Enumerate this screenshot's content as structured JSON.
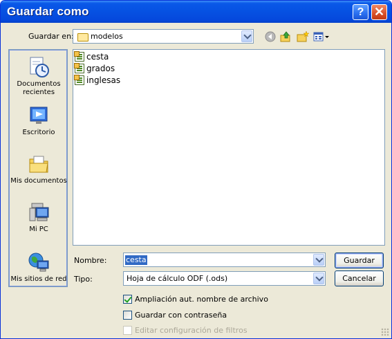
{
  "window": {
    "title": "Guardar como",
    "help_glyph": "?",
    "close_glyph": "✕"
  },
  "location": {
    "label": "Guardar en:",
    "value": "modelos"
  },
  "toolbar": {
    "icons": [
      "back-icon",
      "up-folder-icon",
      "new-folder-icon",
      "view-menu-icon"
    ]
  },
  "places": [
    {
      "label": "Documentos recientes",
      "icon": "recent-documents-icon"
    },
    {
      "label": "Escritorio",
      "icon": "desktop-icon"
    },
    {
      "label": "Mis documentos",
      "icon": "my-documents-icon"
    },
    {
      "label": "Mi PC",
      "icon": "my-computer-icon"
    },
    {
      "label": "Mis sitios de red",
      "icon": "network-places-icon"
    }
  ],
  "files": [
    {
      "name": "cesta",
      "icon": "spreadsheet-icon"
    },
    {
      "name": "grados",
      "icon": "spreadsheet-icon"
    },
    {
      "name": "inglesas",
      "icon": "spreadsheet-icon"
    }
  ],
  "form": {
    "name_label": "Nombre:",
    "name_value": "cesta",
    "type_label": "Tipo:",
    "type_value": "Hoja de cálculo ODF (.ods)"
  },
  "buttons": {
    "save": "Guardar",
    "cancel": "Cancelar"
  },
  "options": [
    {
      "label": "Ampliación aut. nombre de archivo",
      "checked": true,
      "enabled": true
    },
    {
      "label": "Guardar con contraseña",
      "checked": false,
      "enabled": true
    },
    {
      "label": "Editar configuración de filtros",
      "checked": false,
      "enabled": false
    }
  ],
  "colors": {
    "titlebar": "#0548dc",
    "dialog_bg": "#ece9d8",
    "selection": "#316ac5"
  }
}
